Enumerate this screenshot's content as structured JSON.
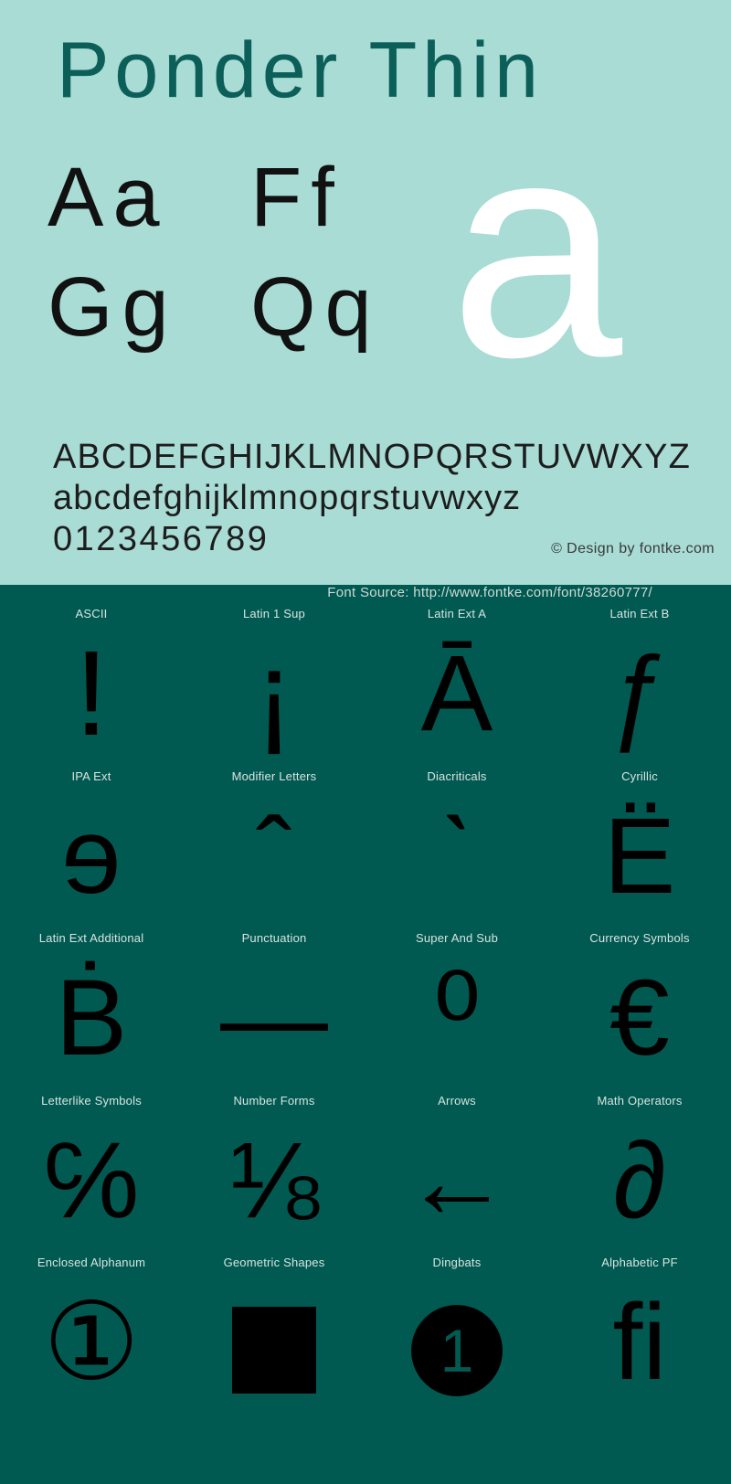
{
  "header": {
    "title": "Ponder Thin",
    "background_color": "#a8dcd5",
    "title_color": "#0c5f58",
    "specimen_pairs": [
      {
        "left": "Aa",
        "right": "Ff"
      },
      {
        "left": "Gg",
        "right": "Qq"
      }
    ],
    "big_glyph": "a",
    "big_glyph_color": "#ffffff",
    "charset": {
      "uppercase": "ABCDEFGHIJKLMNOPQRSTUVWXYZ",
      "lowercase": "abcdefghijklmnopqrstuvwxyz",
      "digits": "0123456789"
    },
    "design_credit": "© Design by fontke.com"
  },
  "source_bar": {
    "text": "Font Source: http://www.fontke.com/font/38260777/",
    "background_color": "#015a51",
    "text_color": "#cfd9d7"
  },
  "blocks": {
    "background_color": "#015a51",
    "label_color": "#d8e3e1",
    "glyph_color": "#000000",
    "rows": [
      [
        {
          "label": "ASCII",
          "glyph": "!",
          "size": "sz-lg",
          "kind": "text"
        },
        {
          "label": "Latin 1 Sup",
          "glyph": "¡",
          "size": "sz-lg",
          "kind": "text"
        },
        {
          "label": "Latin Ext A",
          "glyph": "Ā",
          "size": "",
          "kind": "text"
        },
        {
          "label": "Latin Ext B",
          "glyph": "ƒ",
          "size": "",
          "kind": "text"
        }
      ],
      [
        {
          "label": "IPA Ext",
          "glyph": "ɘ",
          "size": "",
          "kind": "text"
        },
        {
          "label": "Modifier Letters",
          "glyph": "ˆ",
          "size": "",
          "kind": "text"
        },
        {
          "label": "Diacriticals",
          "glyph": "ˋ",
          "size": "",
          "kind": "text"
        },
        {
          "label": "Cyrillic",
          "glyph": "Ё",
          "size": "",
          "kind": "text"
        }
      ],
      [
        {
          "label": "Latin Ext Additional",
          "glyph": "Ḃ",
          "size": "",
          "kind": "text"
        },
        {
          "label": "Punctuation",
          "glyph": "—",
          "size": "",
          "kind": "text"
        },
        {
          "label": "Super And Sub",
          "glyph": "⁰",
          "size": "sz-lg",
          "kind": "text"
        },
        {
          "label": "Currency Symbols",
          "glyph": "€",
          "size": "",
          "kind": "text"
        }
      ],
      [
        {
          "label": "Letterlike Symbols",
          "glyph": "℅",
          "size": "",
          "kind": "text"
        },
        {
          "label": "Number Forms",
          "glyph": "⅛",
          "size": "",
          "kind": "text"
        },
        {
          "label": "Arrows",
          "glyph": "←",
          "size": "",
          "kind": "text"
        },
        {
          "label": "Math Operators",
          "glyph": "∂",
          "size": "",
          "kind": "text"
        }
      ],
      [
        {
          "label": "Enclosed Alphanum",
          "glyph": "①",
          "size": "",
          "kind": "text"
        },
        {
          "label": "Geometric Shapes",
          "glyph": "■",
          "size": "",
          "kind": "square"
        },
        {
          "label": "Dingbats",
          "glyph": "1",
          "size": "",
          "kind": "dingbat"
        },
        {
          "label": "Alphabetic PF",
          "glyph": "ﬁ",
          "size": "",
          "kind": "text"
        }
      ]
    ]
  }
}
